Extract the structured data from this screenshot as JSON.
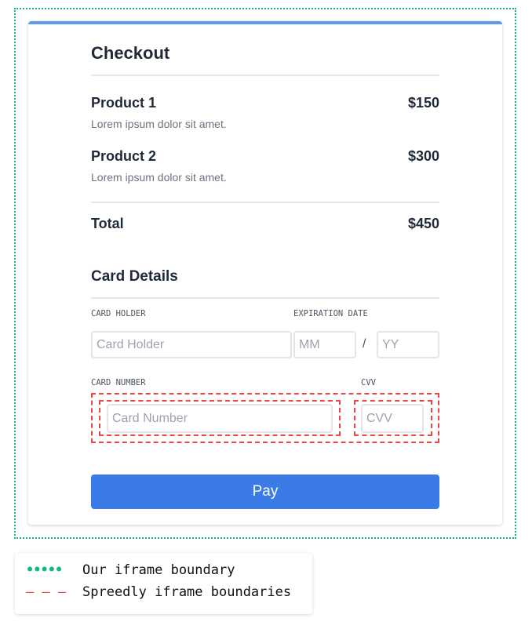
{
  "checkout": {
    "title": "Checkout",
    "products": [
      {
        "name": "Product 1",
        "price": "$150",
        "description": "Lorem ipsum dolor sit amet."
      },
      {
        "name": "Product 2",
        "price": "$300",
        "description": "Lorem ipsum dolor sit amet."
      }
    ],
    "total_label": "Total",
    "total_value": "$450"
  },
  "card_details": {
    "title": "Card Details",
    "card_holder_label": "CARD HOLDER",
    "card_holder_placeholder": "Card Holder",
    "expiration_label": "EXPIRATION DATE",
    "month_placeholder": "MM",
    "separator": "/",
    "year_placeholder": "YY",
    "card_number_label": "CARD NUMBER",
    "card_number_placeholder": "Card Number",
    "cvv_label": "CVV",
    "cvv_placeholder": "CVV"
  },
  "pay_label": "Pay",
  "legend": {
    "items": [
      {
        "symbol": "•••••",
        "label": "Our iframe boundary",
        "color": "#10b981"
      },
      {
        "symbol": "– – –",
        "label": "Spreedly iframe boundaries",
        "color": "#ef4444"
      }
    ]
  },
  "colors": {
    "accent": "#3b7be8",
    "top_border": "#5b9cf0"
  }
}
